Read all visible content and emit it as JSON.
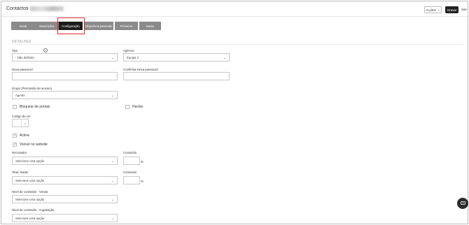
{
  "header": {
    "title": "Contactos",
    "separator": "›",
    "actions_label": "Acções",
    "save_label": "Gravar",
    "exit_label": "Sair"
  },
  "tabs": [
    {
      "label": "Geral",
      "active": false
    },
    {
      "label": "Descrições",
      "active": false
    },
    {
      "label": "Configuração",
      "active": true
    },
    {
      "label": "Objectivos pessoais",
      "active": false
    },
    {
      "label": "Ficheiros",
      "active": false
    },
    {
      "label": "Notas",
      "active": false
    }
  ],
  "section": {
    "title": "DETALHES"
  },
  "form": {
    "tipo": {
      "label": "Tipo",
      "value": "- Não definido -"
    },
    "agencia": {
      "label": "Agência",
      "value": "Equipa 2"
    },
    "nova_password": {
      "label": "Nova password",
      "value": ""
    },
    "confirmar_password": {
      "label": "Confirmar Nova password",
      "value": ""
    },
    "grupo": {
      "label": "Grupo (Permissão de acesso)",
      "value": "Agents"
    },
    "bloquear_portais": {
      "label": "Bloquear de portais",
      "checked": false
    },
    "herdar": {
      "label": "Herdar",
      "checked": false
    },
    "codigo_cor": {
      "label": "Código de cor"
    },
    "activa": {
      "label": "Activa",
      "checked": true
    },
    "visivel_website": {
      "label": "Visível no website",
      "checked": true
    },
    "recrutador": {
      "label": "Recrutador",
      "placeholder": "Selecione uma opção"
    },
    "comissao_1": {
      "label": "Comissão",
      "unit": "%"
    },
    "team_leader": {
      "label": "Team leader",
      "placeholder": "Selecione uma opção"
    },
    "comissao_2": {
      "label": "Comissão",
      "unit": "%"
    },
    "nivel_venda": {
      "label": "Nível de comissão - Venda",
      "placeholder": "Selecione uma opção"
    },
    "nivel_angariacao": {
      "label": "Nível de comissão - Angariação",
      "placeholder": "Selecione uma opção"
    }
  },
  "chat": {
    "label": "💬"
  }
}
